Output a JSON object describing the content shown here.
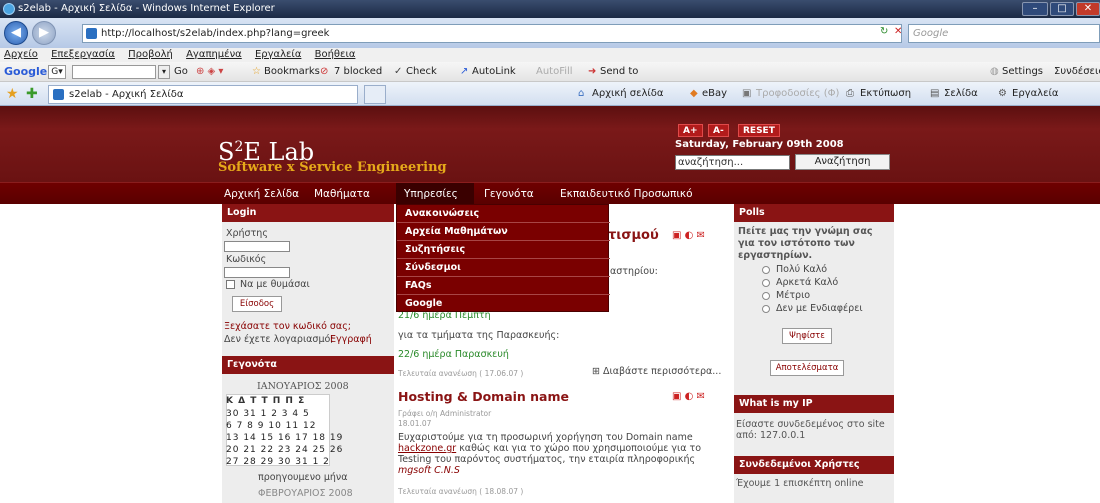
{
  "browser": {
    "title": "s2elab - Αρχική Σελίδα - Windows Internet Explorer",
    "url": "http://localhost/s2elab/index.php?lang=greek",
    "search_placeholder": "Google",
    "menu": [
      "Αρχείο",
      "Επεξεργασία",
      "Προβολή",
      "Αγαπημένα",
      "Εργαλεία",
      "Βοήθεια"
    ],
    "google_toolbar": {
      "logo": "Google",
      "go": "Go",
      "bookmarks": "Bookmarks",
      "blocked": "7 blocked",
      "check": "Check",
      "autolink": "AutoLink",
      "autofill": "AutoFill",
      "sendto": "Send to",
      "settings": "Settings",
      "signin": "Συνδέσεις"
    },
    "tab_title": "s2elab - Αρχική Σελίδα",
    "command_bar": {
      "home": "Αρχική σελίδα",
      "ebay": "eBay",
      "feeds": "Τροφοδοσίες (Φ)",
      "print": "Εκτύπωση",
      "page": "Σελίδα",
      "tools": "Εργαλεία"
    }
  },
  "site": {
    "logo": "S",
    "logo_sup": "2",
    "logo_rest": "E Lab",
    "slogan": "Software x Service Engineering",
    "font_buttons": [
      "A+",
      "A-",
      "RESET"
    ],
    "date": "Saturday, February 09th 2008",
    "search_value": "αναζήτηση...",
    "search_button": "Αναζήτηση",
    "nav": [
      "Αρχική Σελίδα",
      "Μαθήματα",
      "Υπηρεσίες",
      "Γεγονότα",
      "Εκπαιδευτικό Προσωπικό"
    ],
    "dropdown": [
      "Ανακοινώσεις",
      "Αρχεία Μαθημάτων",
      "Συζητήσεις",
      "Σύνδεσμοι",
      "FAQs",
      "Google"
    ]
  },
  "login": {
    "header": "Login",
    "user_label": "Χρήστης",
    "pass_label": "Κωδικός",
    "remember": "Να με θυμάσαι",
    "submit": "Είσοδος",
    "forgot": "Ξεχάσατε τον κωδικό σας;",
    "no_account": "Δεν έχετε λογαριασμό;",
    "register": "Εγγραφή"
  },
  "events": {
    "header": "Γεγονότα",
    "month1": "ΙΑΝΟΥΑΡΙΟΣ 2008",
    "weekdays": "Κ Δ Τ Τ Π Π Σ",
    "rows": [
      "30 31  1  2  3  4  5",
      " 6  7  8  9 10 11 12",
      "13 14 15 16 17 18 19",
      "20 21 22 23 24 25 26",
      "27 28 29 30 31  1  2"
    ],
    "prev": "προηγουμενο μήνα",
    "month2": "ΦΕΒΡΟΥΑΡΙΟΣ 2008"
  },
  "main": {
    "article1_title_tail": "τισμού",
    "article1_text_tail": "αστηρίου:",
    "date1": "21/6 ημέρα Πέμπτη",
    "text2": "για τα τμήματα της Παρασκευής:",
    "date2": "22/6 ημέρα Παρασκευή",
    "updated1": "Τελευταία ανανέωση ( 17.06.07 )",
    "readmore": "Διαβάστε περισσότερα...",
    "article2_title": "Hosting & Domain name",
    "author": "Γράφει ο/η Administrator",
    "date_written": "18.01.07",
    "body_1": "Ευχαριστούμε για τη προσωρινή χορήγηση του Domain name",
    "body_link": "hackzone.gr",
    "body_2": " καθώς και για το χώρο που χρησιμοποιούμε για το",
    "body_3": "Testing του παρόντος συστήματος, την εταιρία πληροφορικής",
    "body_4": "mgsoft C.N.S",
    "updated2": "Τελευταία ανανέωση ( 18.08.07 )"
  },
  "polls": {
    "header": "Polls",
    "question": "Πείτε μας την γνώμη σας για τον ιστότοπο των εργαστηρίων.",
    "options": [
      "Πολύ Καλό",
      "Αρκετά Καλό",
      "Μέτριο",
      "Δεν με Ενδιαφέρει"
    ],
    "vote": "Ψηφίστε",
    "results": "Αποτελέσματα"
  },
  "ip": {
    "header": "What is my IP",
    "text": "Είσαστε συνδεδεμένος στο site από: 127.0.0.1"
  },
  "online": {
    "header": "Συνδεδεμένοι Χρήστες",
    "text": "Έχουμε 1 επισκέπτη online"
  }
}
